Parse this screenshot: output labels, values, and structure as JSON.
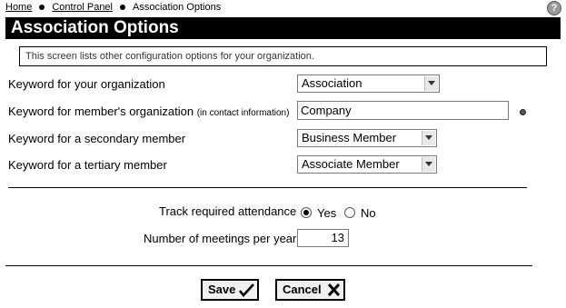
{
  "breadcrumb": {
    "home": "Home",
    "control_panel": "Control Panel",
    "current": "Association Options"
  },
  "help_icon": "?",
  "title": "Association Options",
  "info_text": "This screen lists other configuration options for your organization.",
  "fields": {
    "org_keyword": {
      "label": "Keyword for your organization",
      "value": "Association"
    },
    "member_org_keyword": {
      "label": "Keyword for member's organization",
      "note": "(in contact information)",
      "value": "Company"
    },
    "secondary_keyword": {
      "label": "Keyword for a secondary member",
      "value": "Business Member"
    },
    "tertiary_keyword": {
      "label": "Keyword for a tertiary member",
      "value": "Associate Member"
    },
    "attendance": {
      "label": "Track required attendance",
      "yes": "Yes",
      "no": "No",
      "selected": "Yes"
    },
    "meetings": {
      "label": "Number of meetings per year",
      "value": "13"
    }
  },
  "buttons": {
    "save": "Save",
    "cancel": "Cancel"
  },
  "icons": {
    "help": "help-icon",
    "dropdown": "chevron-down-icon",
    "save": "checkmark-icon",
    "cancel": "x-icon",
    "required": "bullet-icon"
  }
}
